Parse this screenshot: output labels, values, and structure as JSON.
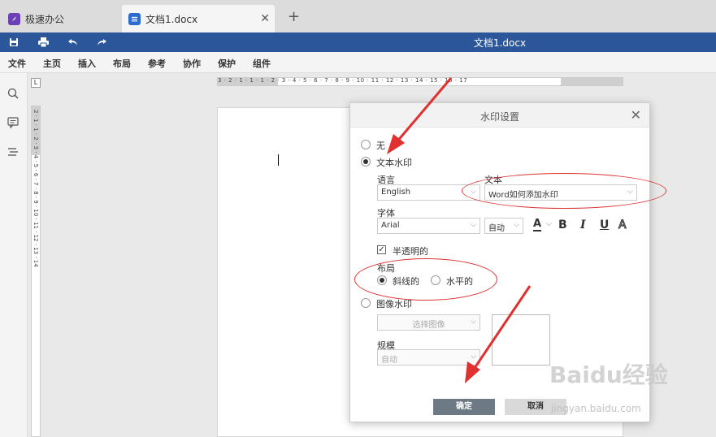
{
  "tabs": [
    {
      "label": "极速办公",
      "icon": "rocket-icon"
    },
    {
      "label": "文档1.docx",
      "icon": "document-icon"
    }
  ],
  "titlebar": {
    "doc_title": "文档1.docx"
  },
  "menu": [
    "文件",
    "主页",
    "插入",
    "布局",
    "参考",
    "协作",
    "保护",
    "组件"
  ],
  "ruler": {
    "corner": "L",
    "h_text": "3 · 2 · 1 · 1 · 1 · 2 · 3 · 4 · 5 · 6 · 7 · 8 · 9 · 10 · 11 · 12 · 13 · 14 · 15 · 16 · 17",
    "v_text": "2 · 1 · 1 · 2 · 3 · 4 · 5 · 6 · 7 · 8 · 9 · 10 · 11 · 12 · 13 · 14"
  },
  "dialog": {
    "title": "水印设置",
    "close": "✕",
    "option_none": "无",
    "option_text": "文本水印",
    "language_label": "语言",
    "language_value": "English",
    "text_label": "文本",
    "text_value": "Word如何添加水印",
    "font_label": "字体",
    "font_value": "Arial",
    "size_value": "自动",
    "format_buttons": {
      "color": "A",
      "bold": "B",
      "italic": "I",
      "underline": "U",
      "outline": "A"
    },
    "semi_transparent": "半透明的",
    "layout_label": "布局",
    "layout_diagonal": "斜线的",
    "layout_horizontal": "水平的",
    "option_image": "图像水印",
    "select_image": "选择图像",
    "scale_label": "规模",
    "scale_value": "自动",
    "ok": "确定",
    "cancel": "取消"
  },
  "watermark": {
    "brand": "Baidu经验",
    "url": "jingyan.baidu.com"
  },
  "colors": {
    "titlebar": "#2b579a",
    "annotation": "#dd3333",
    "ok_button": "#6d7a86"
  }
}
